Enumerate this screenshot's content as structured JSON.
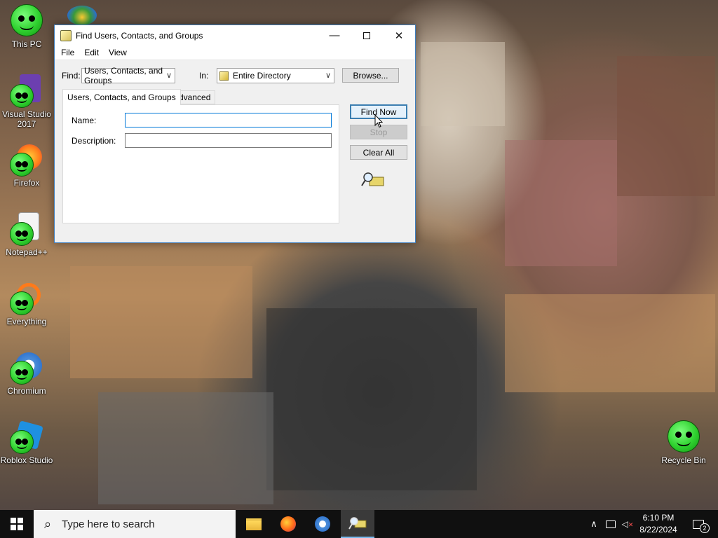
{
  "desktop": {
    "icons": [
      {
        "label": "This PC"
      },
      {
        "label": "Visual Studio 2017"
      },
      {
        "label": "Firefox"
      },
      {
        "label": "Notepad++"
      },
      {
        "label": "Everything"
      },
      {
        "label": "Chromium"
      },
      {
        "label": "Roblox Studio"
      },
      {
        "label": "Recycle Bin"
      }
    ]
  },
  "window": {
    "title": "Find Users, Contacts, and Groups",
    "menu": [
      "File",
      "Edit",
      "View"
    ],
    "find_label": "Find:",
    "find_value": "Users, Contacts, and Groups",
    "in_label": "In:",
    "in_value": "Entire Directory",
    "browse_label": "Browse...",
    "tabs": [
      "Users, Contacts, and Groups",
      "Advanced"
    ],
    "name_label": "Name:",
    "name_value": "",
    "description_label": "Description:",
    "description_value": "",
    "find_now_label": "Find Now",
    "stop_label": "Stop",
    "clear_all_label": "Clear All"
  },
  "taskbar": {
    "search_placeholder": "Type here to search",
    "time": "6:10 PM",
    "date": "8/22/2024",
    "notification_count": "2"
  }
}
